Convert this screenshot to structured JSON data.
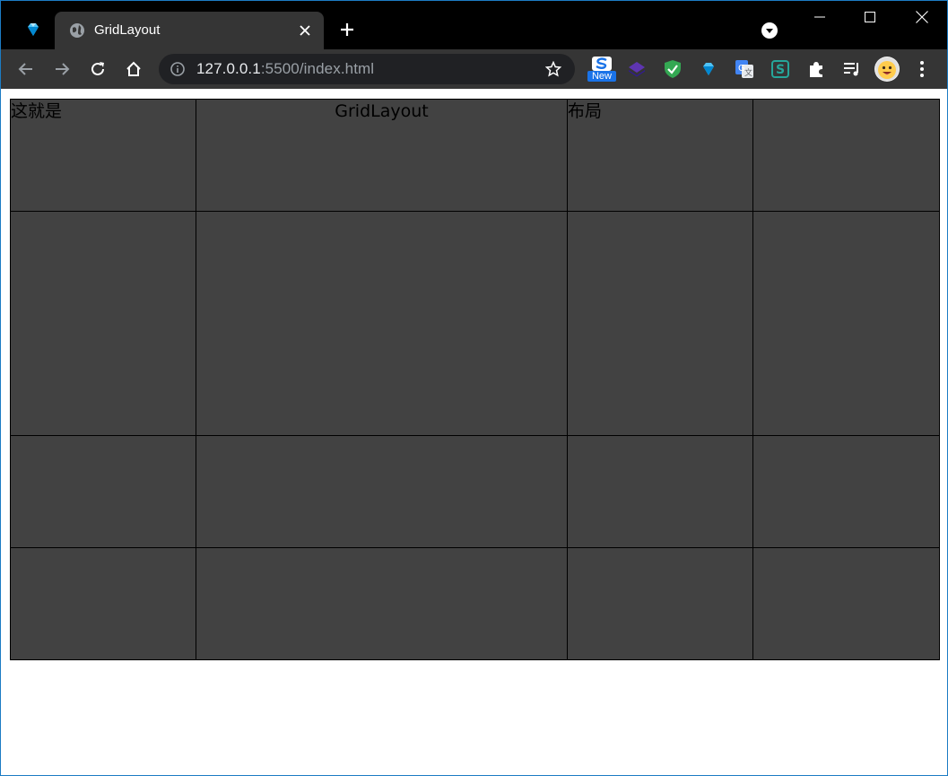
{
  "browser": {
    "tab": {
      "title": "GridLayout"
    },
    "address": {
      "host": "127.0.0.1",
      "rest": ":5500/index.html"
    },
    "extensions": {
      "new_badge": "New"
    }
  },
  "page": {
    "grid": {
      "columns": 4,
      "rows": 4,
      "cells": [
        {
          "text": "这就是",
          "align": "left"
        },
        {
          "text": "GridLayout",
          "align": "center"
        },
        {
          "text": "布局",
          "align": "left"
        },
        {
          "text": ""
        },
        {
          "text": ""
        },
        {
          "text": ""
        },
        {
          "text": ""
        },
        {
          "text": ""
        },
        {
          "text": ""
        },
        {
          "text": ""
        },
        {
          "text": ""
        },
        {
          "text": ""
        },
        {
          "text": ""
        },
        {
          "text": ""
        },
        {
          "text": ""
        },
        {
          "text": ""
        }
      ],
      "cell_color": "#424242",
      "border_color": "#000000"
    }
  },
  "colors": {
    "titlebar": "#000000",
    "toolbar": "#353535",
    "omnibox": "#202124",
    "window_border": "#1c7cc4"
  }
}
